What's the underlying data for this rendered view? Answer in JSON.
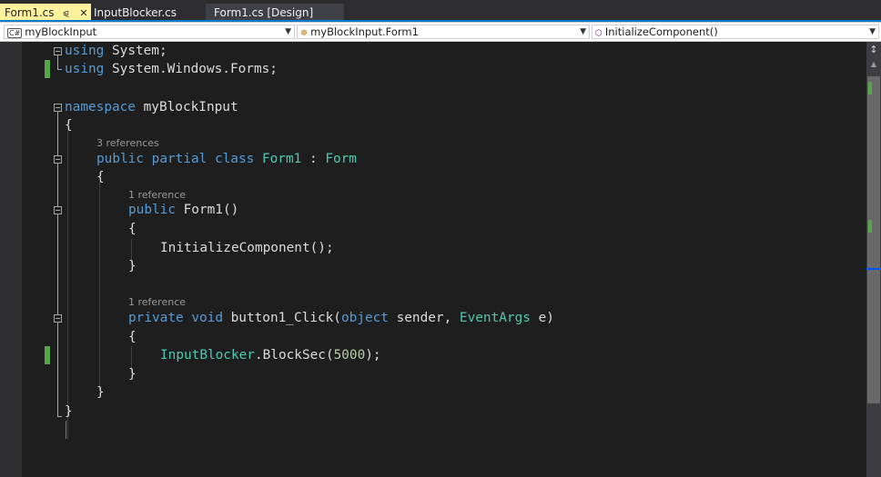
{
  "tabs": [
    {
      "label": "Form1.cs",
      "pin_icon": "pin-icon",
      "close_icon": "close-icon",
      "active": true
    },
    {
      "label": "InputBlocker.cs",
      "active": false
    },
    {
      "label": "Form1.cs [Design]",
      "active": false
    }
  ],
  "navbar": {
    "project": "myBlockInput",
    "type": "myBlockInput.Form1",
    "member": "InitializeComponent()"
  },
  "code": {
    "l1": {
      "kw": "using",
      "rest": " System;"
    },
    "l2": {
      "kw": "using",
      "rest": " System.Windows.Forms;"
    },
    "l4": {
      "kw": "namespace",
      "rest": " myBlockInput"
    },
    "l5": "{",
    "lens_class": "3 references",
    "l6": {
      "kw1": "public",
      "kw2": "partial",
      "kw3": "class",
      "name": "Form1",
      "colon": " : ",
      "base": "Form"
    },
    "l7": "{",
    "lens_ctor": "1 reference",
    "l8": {
      "kw": "public",
      "rest": " Form1()"
    },
    "l9": "{",
    "l10": "InitializeComponent();",
    "l11": "}",
    "lens_click": "1 reference",
    "l13": {
      "kw1": "private",
      "kw2": "void",
      "name": " button1_Click(",
      "kw3": "object",
      "p1": " sender, ",
      "type": "EventArgs",
      "p2": " e)"
    },
    "l14": "{",
    "l15": {
      "type": "InputBlocker",
      "mid": ".BlockSec(",
      "num": "5000",
      "end": ");"
    },
    "l16": "}",
    "l17": "}",
    "l18": "}"
  },
  "colors": {
    "keyword": "#569cd6",
    "type": "#4ec9b0",
    "number": "#b5cea8",
    "text": "#dcdcdc",
    "change_mark": "#57a64a",
    "active_tab": "#fff29d",
    "accent": "#007acc"
  }
}
